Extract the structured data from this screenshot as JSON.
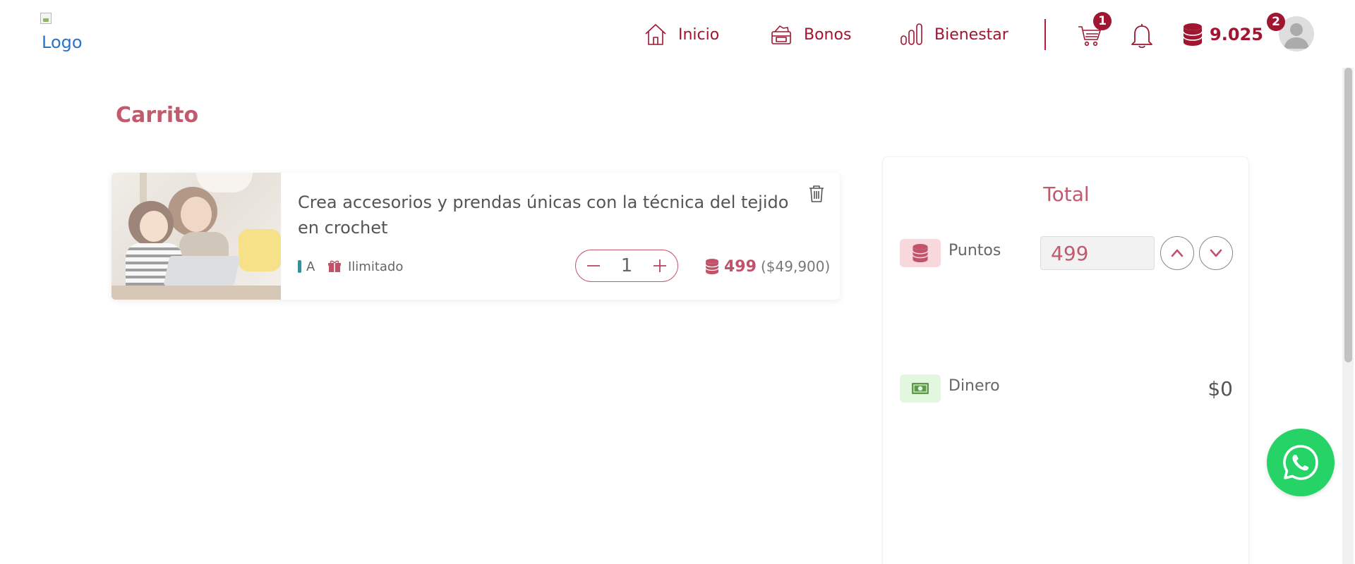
{
  "header": {
    "logo_alt": "Logo",
    "nav": [
      {
        "label": "Inicio",
        "icon": "home-icon"
      },
      {
        "label": "Bonos",
        "icon": "gift-icon"
      },
      {
        "label": "Bienestar",
        "icon": "bar-chart-icon"
      }
    ],
    "cart_badge": "1",
    "points_balance": "9.025",
    "user_badge": "2"
  },
  "page": {
    "title": "Carrito"
  },
  "cart_items": [
    {
      "title": "Crea accesorios y prendas únicas con la técnica del tejido en crochet",
      "tag": "A",
      "availability": "Ilimitado",
      "quantity": "1",
      "points": "499",
      "money": "($49,900)"
    }
  ],
  "total": {
    "title": "Total",
    "points_label": "Puntos",
    "points_value": "499",
    "cash_label": "Dinero",
    "cash_value": "$0"
  },
  "colors": {
    "brand": "#a0152f",
    "accent_soft": "#c05a6c",
    "whatsapp": "#25d366"
  }
}
